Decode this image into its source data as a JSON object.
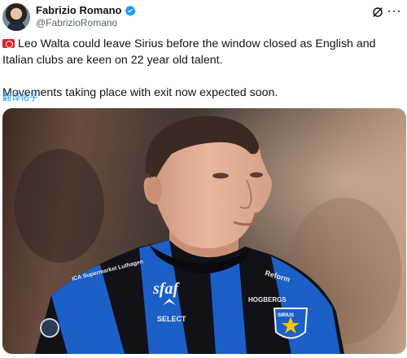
{
  "author": {
    "display_name": "Fabrizio Romano",
    "handle": "@FabrizioRomano",
    "verified": true,
    "verified_color": "#1d9bf0"
  },
  "tweet": {
    "line1_text": "Leo Walta could leave Sirius before the window closed as English and Italian clubs are keen on 22 year old talent.",
    "line2_text": "Movements taking place with exit now expected soon.",
    "translate_label": "翻译帖子"
  },
  "media": {
    "kit_text_sponsor": "sfaf",
    "kit_text_brand": "SELECT",
    "kit_text_left": "ICA Supermarket Luthagen",
    "kit_text_right_top": "Reform",
    "kit_text_right_bottom": "HOGBERGS",
    "badge_text": "SIRIUS"
  },
  "icons": {
    "flag": "red-siren-flag-icon",
    "verified": "verified-badge-icon",
    "grok": "grok-icon",
    "more": "more-dots-icon"
  }
}
